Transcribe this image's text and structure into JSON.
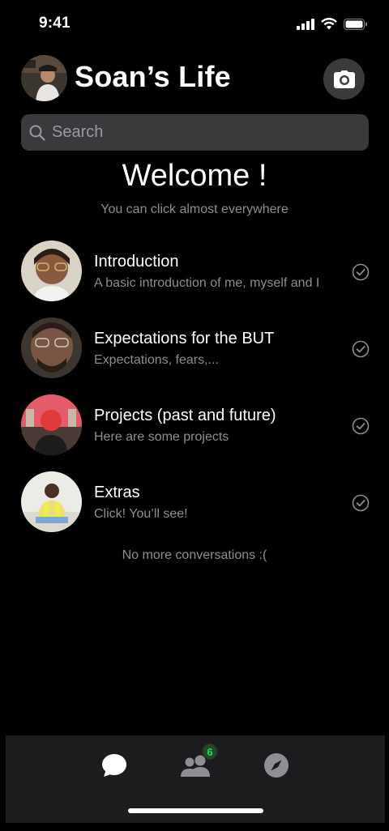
{
  "status_bar": {
    "time": "9:41"
  },
  "header": {
    "title": "Soan’s Life",
    "avatar_icon": "profile-avatar",
    "camera_icon": "camera-icon"
  },
  "search": {
    "placeholder": "Search",
    "value": ""
  },
  "welcome": {
    "title": "Welcome !",
    "subtitle": "You can click almost everywhere"
  },
  "conversations": [
    {
      "title": "Introduction",
      "subtitle": "A basic introduction of me, myself and I",
      "avatar_color": "#9a7a5e"
    },
    {
      "title": "Expectations for the BUT",
      "subtitle": "Expectations, fears,...",
      "avatar_color": "#6a5140"
    },
    {
      "title": "Projects (past and future)",
      "subtitle": "Here are some projects",
      "avatar_color": "#d94b5a"
    },
    {
      "title": "Extras",
      "subtitle": "Click! You’ll see!",
      "avatar_color": "#c9b27a"
    }
  ],
  "footer": {
    "no_more": "No more conversations :("
  },
  "tabbar": {
    "tabs": [
      {
        "icon": "chat-bubble-icon",
        "active": true
      },
      {
        "icon": "people-icon",
        "active": false,
        "badge": "6"
      },
      {
        "icon": "compass-icon",
        "active": false
      }
    ]
  },
  "colors": {
    "background": "#000000",
    "surface": "#3a3a3c",
    "muted_text": "#8e8e93",
    "badge": "#30d158"
  }
}
